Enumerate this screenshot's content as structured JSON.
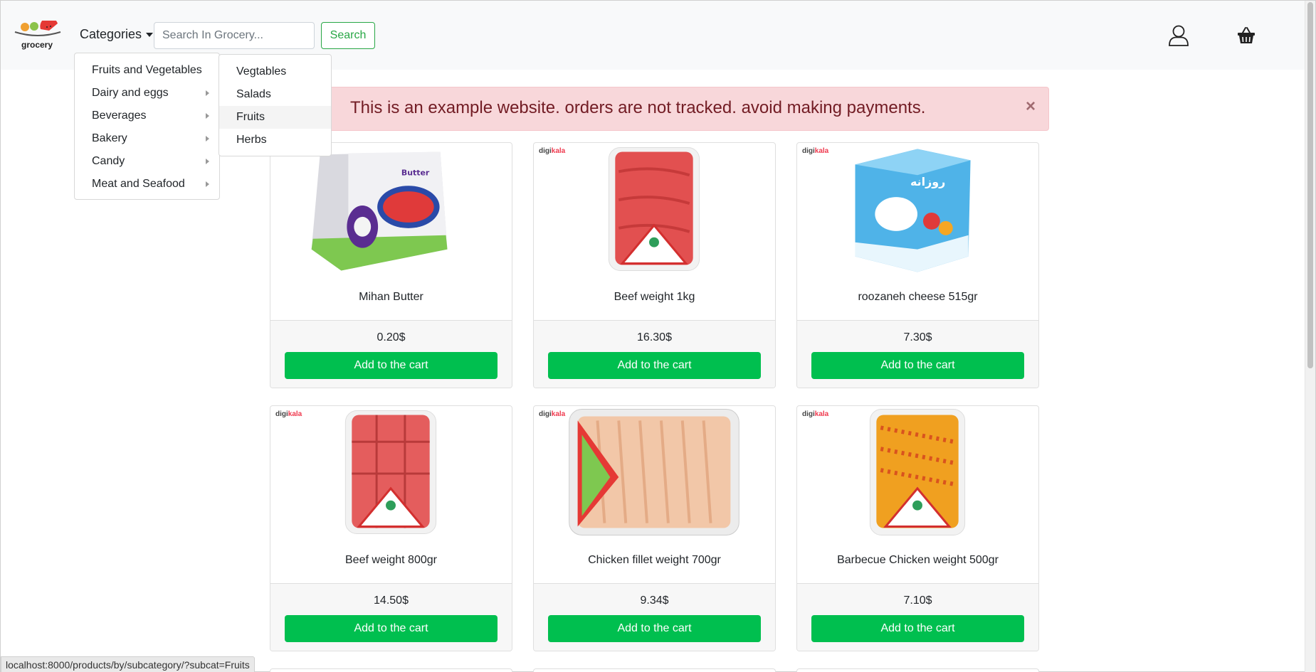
{
  "navbar": {
    "logo_text": "grocery",
    "categories_label": "Categories",
    "search_placeholder": "Search In Grocery...",
    "search_button": "Search",
    "user_icon": "user-icon",
    "cart_icon": "basket-icon"
  },
  "categories_menu": {
    "items": [
      {
        "label": "Fruits and Vegetables",
        "has_submenu": true
      },
      {
        "label": "Dairy and eggs",
        "has_submenu": true
      },
      {
        "label": "Beverages",
        "has_submenu": true
      },
      {
        "label": "Bakery",
        "has_submenu": true
      },
      {
        "label": "Candy",
        "has_submenu": true
      },
      {
        "label": "Meat and Seafood",
        "has_submenu": true
      }
    ],
    "submenu": [
      {
        "label": "Vegtables"
      },
      {
        "label": "Salads"
      },
      {
        "label": "Fruits",
        "hovered": true
      },
      {
        "label": "Herbs"
      }
    ]
  },
  "alert": {
    "text": "This is an example website. orders are not tracked. avoid making payments.",
    "close": "×"
  },
  "products": [
    {
      "name": "Mihan Butter",
      "price": "0.20$",
      "button": "Add to the cart"
    },
    {
      "name": "Beef weight 1kg",
      "price": "16.30$",
      "button": "Add to the cart",
      "brand": "digikala"
    },
    {
      "name": "roozaneh cheese 515gr",
      "price": "7.30$",
      "button": "Add to the cart",
      "brand": "digikala"
    },
    {
      "name": "Beef weight 800gr",
      "price": "14.50$",
      "button": "Add to the cart",
      "brand": "digikala"
    },
    {
      "name": "Chicken fillet weight 700gr",
      "price": "9.34$",
      "button": "Add to the cart",
      "brand": "digikala"
    },
    {
      "name": "Barbecue Chicken weight 500gr",
      "price": "7.10$",
      "button": "Add to the cart",
      "brand": "digikala"
    }
  ],
  "status_url": "localhost:8000/products/by/subcategory/?subcat=Fruits",
  "colors": {
    "primary_green": "#00bf4f",
    "outline_green": "#28a745",
    "alert_bg": "#f8d7da",
    "alert_text": "#721c24"
  }
}
